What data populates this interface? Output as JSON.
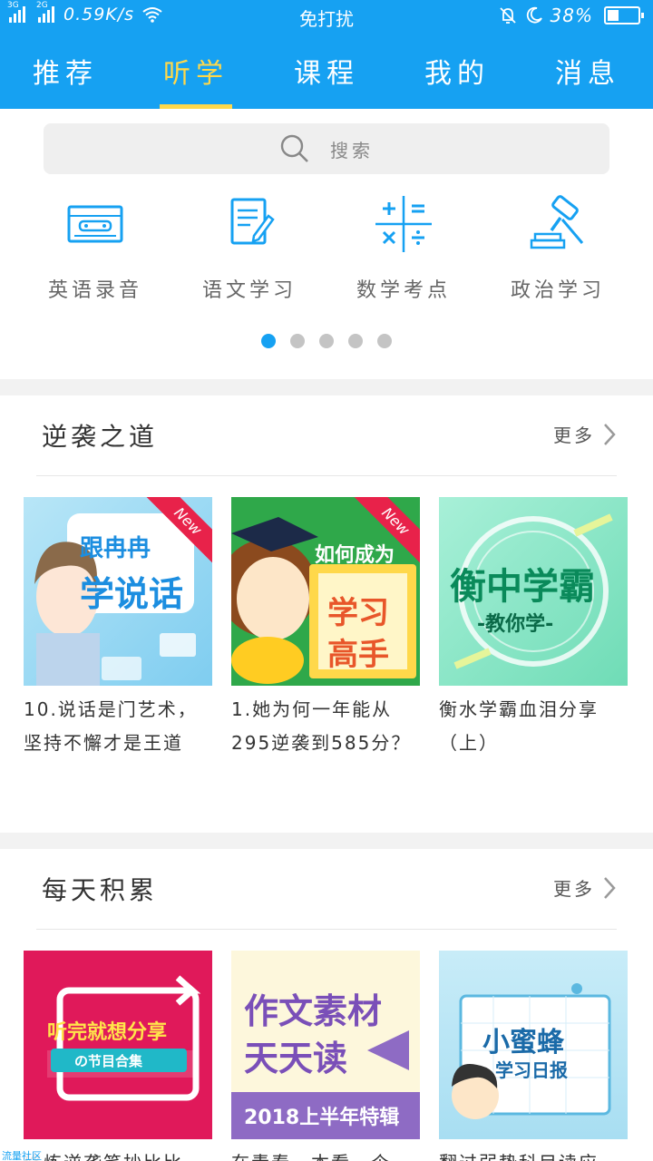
{
  "status_bar": {
    "net1": "3G",
    "net2": "2G",
    "speed": "0.59K/s",
    "center": "免打扰",
    "battery_pct": "38%",
    "battery_level": 0.38
  },
  "tabs": [
    {
      "label": "推荐"
    },
    {
      "label": "听学"
    },
    {
      "label": "课程"
    },
    {
      "label": "我的"
    },
    {
      "label": "消息"
    }
  ],
  "active_tab_index": 1,
  "search": {
    "placeholder": "搜索"
  },
  "quick_entries": [
    {
      "label": "英语录音",
      "icon": "cassette-icon"
    },
    {
      "label": "语文学习",
      "icon": "notebook-pen-icon"
    },
    {
      "label": "数学考点",
      "icon": "math-symbols-icon"
    },
    {
      "label": "政治学习",
      "icon": "gavel-icon"
    }
  ],
  "pager": {
    "count": 5,
    "active": 0
  },
  "sections": [
    {
      "title": "逆袭之道",
      "more": "更多",
      "cards": [
        {
          "caption": "10.说话是门艺术，坚持不懈才是王道",
          "thumb_lines": [
            "跟冉冉",
            "学说话"
          ],
          "badge": "New"
        },
        {
          "caption": "1.她为何一年能从295逆袭到585分？",
          "thumb_lines": [
            "如何成为",
            "学习",
            "高手"
          ],
          "badge": "New"
        },
        {
          "caption": "衡水学霸血泪分享（上）",
          "thumb_lines": [
            "衡中学霸",
            "-教你学-"
          ],
          "badge": ""
        }
      ]
    },
    {
      "title": "每天积累",
      "more": "更多",
      "cards": [
        {
          "caption": "修炼逆袭笔抄比比",
          "thumb_lines": [
            "听完就想分享",
            "の节目合集"
          ],
          "badge": ""
        },
        {
          "caption": "在青春一本看一个",
          "thumb_lines": [
            "作文素材",
            "天天读",
            "2018上半年特辑"
          ],
          "badge": ""
        },
        {
          "caption": "翻过弱势科目读应",
          "thumb_lines": [
            "小蜜蜂",
            "学习日报"
          ],
          "badge": ""
        }
      ]
    }
  ],
  "watermark": "流量社区",
  "colors": {
    "primary": "#16a1f2",
    "active_tab": "#ffd84a",
    "new_badge": "#e8224a"
  }
}
